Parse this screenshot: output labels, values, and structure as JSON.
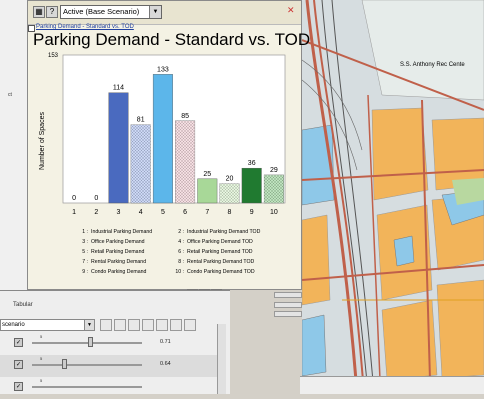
{
  "toolbar": {
    "scenario_value": "Active (Base Scenario)"
  },
  "chart_window": {
    "link_text": "Parking Demand - Standard vs. TOD"
  },
  "chart_data": {
    "type": "bar",
    "title": "Parking Demand - Standard vs. TOD",
    "ylabel": "Number of Spaces",
    "xlabel": "",
    "ylim": [
      0,
      153
    ],
    "ymax_label": "153",
    "categories": [
      "1",
      "2",
      "3",
      "4",
      "5",
      "6",
      "7",
      "8",
      "9",
      "10"
    ],
    "values": [
      0,
      0,
      114,
      81,
      133,
      85,
      25,
      20,
      36,
      29
    ],
    "bar_colors": [
      "#4466bb",
      "#6688dd",
      "#4a6abf",
      "#8fa8e8",
      "#5cb6ea",
      "#e8b8c0",
      "#a8d898",
      "#c8e8b8",
      "#207a30",
      "#70c070"
    ],
    "hatched": [
      false,
      true,
      false,
      true,
      false,
      true,
      false,
      true,
      false,
      true
    ],
    "grid": false,
    "legend_placement": "bottom"
  },
  "legend": [
    {
      "key": "1 :",
      "label": "Industrial Parking Demand"
    },
    {
      "key": "2 :",
      "label": "Industrial Parking Demand TOD"
    },
    {
      "key": "3 :",
      "label": "Office Parking Demand"
    },
    {
      "key": "4 :",
      "label": "Office Parking Demand TOD"
    },
    {
      "key": "5 :",
      "label": "Retail Parking Demand"
    },
    {
      "key": "6 :",
      "label": "Retail Parking Demand TOD"
    },
    {
      "key": "7 :",
      "label": "Rental Parking Demand"
    },
    {
      "key": "8 :",
      "label": "Rental Parking Demand TOD"
    },
    {
      "key": "9 :",
      "label": "Condo Parking Demand"
    },
    {
      "key": "10 :",
      "label": "Condo Parking Demand TOD"
    }
  ],
  "map": {
    "place_label": "S.S. Anthony Rec Cente"
  },
  "tabular": {
    "tab_label": "Tabular",
    "scenario_field": "scenario",
    "slider1_value": "0.71",
    "slider2_value": "0.64",
    "tick_label": "5"
  },
  "colors": {
    "map_road": "#c0604a",
    "map_block": "#f2b45a",
    "map_water": "#8ec8e8",
    "map_park": "#b8d8a0"
  }
}
